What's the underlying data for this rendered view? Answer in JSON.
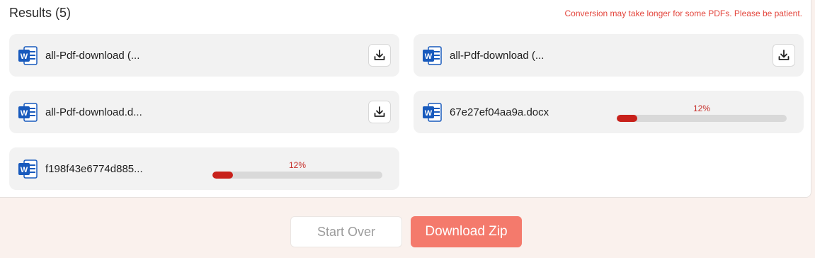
{
  "results": {
    "title": "Results (5)",
    "notice": "Conversion may take longer for some PDFs. Please be patient.",
    "files": [
      {
        "name": "all-Pdf-download (...",
        "status": "done",
        "icon": "word-doc-icon"
      },
      {
        "name": "all-Pdf-download (...",
        "status": "done",
        "icon": "word-doc-icon"
      },
      {
        "name": "all-Pdf-download.d...",
        "status": "done",
        "icon": "word-doc-icon"
      },
      {
        "name": "67e27ef04aa9a.docx",
        "status": "converting",
        "progress_label": "12%",
        "progress": 0.12,
        "icon": "word-doc-icon"
      },
      {
        "name": "f198f43e6774d885...",
        "status": "converting",
        "progress_label": "12%",
        "progress": 0.12,
        "icon": "word-doc-icon"
      }
    ]
  },
  "actions": {
    "start_over": "Start Over",
    "download_zip": "Download Zip"
  },
  "colors": {
    "accent": "#f47a6c",
    "progress": "#c8211b",
    "notice": "#e3453c",
    "word_blue": "#185abd"
  }
}
